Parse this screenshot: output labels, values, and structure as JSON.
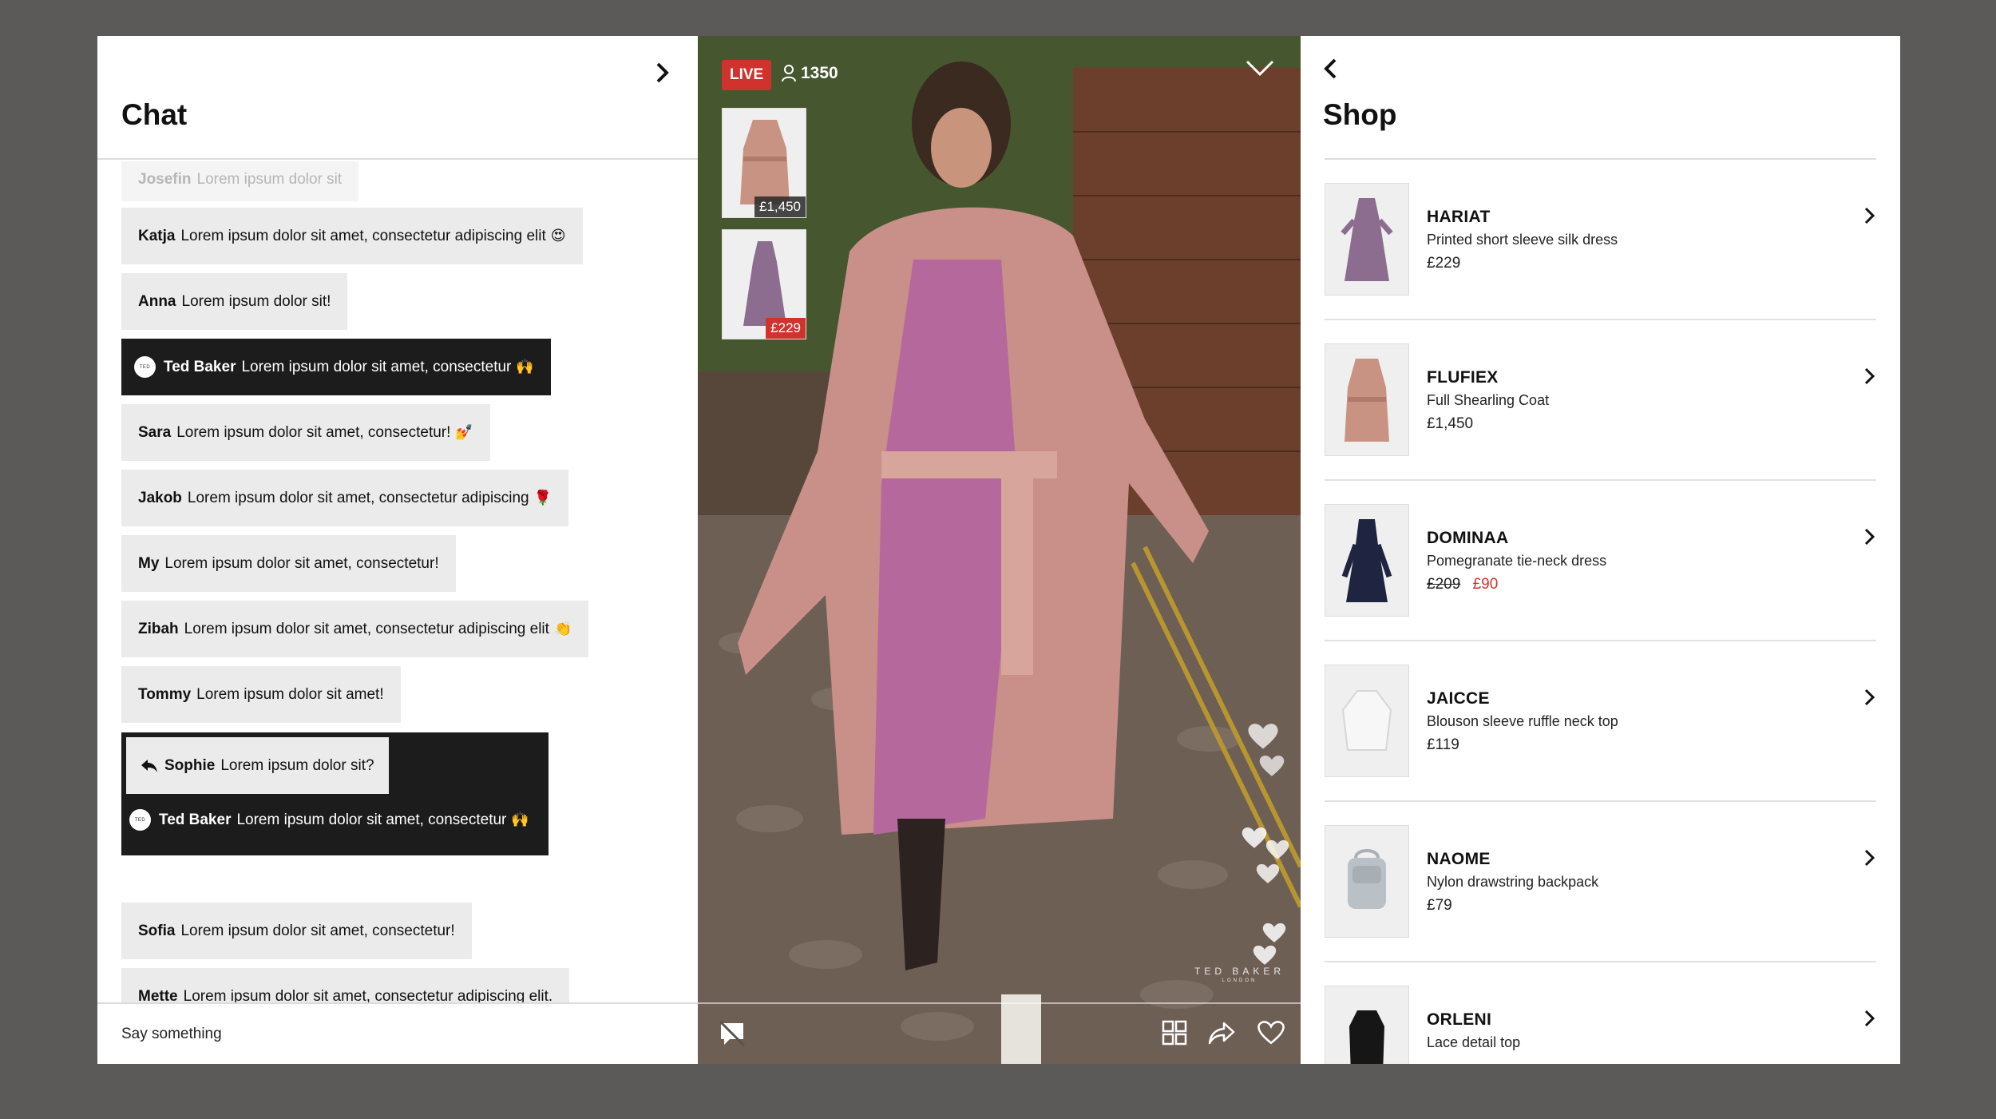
{
  "chat": {
    "title": "Chat",
    "input_placeholder": "Say something",
    "messages": [
      {
        "user": "Josefin",
        "text": "Lorem ipsum dolor sit",
        "emoji": ""
      },
      {
        "user": "Katja",
        "text": "Lorem ipsum dolor sit amet, consectetur adipiscing elit",
        "emoji": "😍"
      },
      {
        "user": "Anna",
        "text": "Lorem ipsum dolor sit!",
        "emoji": ""
      },
      {
        "user": "Ted Baker",
        "text": "Lorem ipsum dolor sit amet, consectetur",
        "emoji": "🙌"
      },
      {
        "user": "Sara",
        "text": "Lorem ipsum dolor sit amet, consectetur!",
        "emoji": "💅"
      },
      {
        "user": "Jakob",
        "text": "Lorem ipsum dolor sit amet, consectetur adipiscing",
        "emoji": "🌹"
      },
      {
        "user": "My",
        "text": "Lorem ipsum dolor sit amet, consectetur!",
        "emoji": ""
      },
      {
        "user": "Zibah",
        "text": "Lorem ipsum dolor sit amet, consectetur adipiscing elit",
        "emoji": "👏"
      },
      {
        "user": "Tommy",
        "text": "Lorem ipsum dolor sit amet!",
        "emoji": ""
      },
      {
        "user": "Sofia",
        "text": "Lorem ipsum dolor sit amet, consectetur!",
        "emoji": ""
      },
      {
        "user": "Mette",
        "text": "Lorem ipsum dolor sit amet, consectetur adipiscing elit.",
        "emoji": ""
      }
    ],
    "reply": {
      "quoted_user": "Sophie",
      "quoted_text": "Lorem ipsum dolor sit?",
      "user": "Ted Baker",
      "text": "Lorem ipsum dolor sit amet, consectetur",
      "emoji": "🙌"
    }
  },
  "video": {
    "live_label": "LIVE",
    "viewers": "1350",
    "featured": [
      {
        "price": "£1,450",
        "sale": false
      },
      {
        "price": "£229",
        "sale": true
      }
    ],
    "brand_mark": "TED BAKER",
    "brand_sub": "LONDON"
  },
  "shop": {
    "title": "Shop",
    "products": [
      {
        "name": "HARIAT",
        "desc": "Printed short sleeve silk dress",
        "price": "£229",
        "old_price": "",
        "icon": "dress-icon"
      },
      {
        "name": "FLUFIEX",
        "desc": "Full Shearling Coat",
        "price": "£1,450",
        "old_price": "",
        "icon": "coat-icon"
      },
      {
        "name": "DOMINAA",
        "desc": "Pomegranate tie-neck dress",
        "price": "£90",
        "old_price": "£209",
        "icon": "dark-dress-icon"
      },
      {
        "name": "JAICCE",
        "desc": "Blouson sleeve ruffle neck top",
        "price": "£119",
        "old_price": "",
        "icon": "blouse-icon"
      },
      {
        "name": "NAOME",
        "desc": "Nylon drawstring backpack",
        "price": "£79",
        "old_price": "",
        "icon": "backpack-icon"
      },
      {
        "name": "ORLENI",
        "desc": "Lace detail top",
        "price": "",
        "old_price": "",
        "icon": "top-icon"
      }
    ]
  },
  "colors": {
    "accent_red": "#d0322d",
    "dark": "#1c1c1c",
    "bubble": "#ebebeb",
    "backdrop": "#5c5a59"
  }
}
